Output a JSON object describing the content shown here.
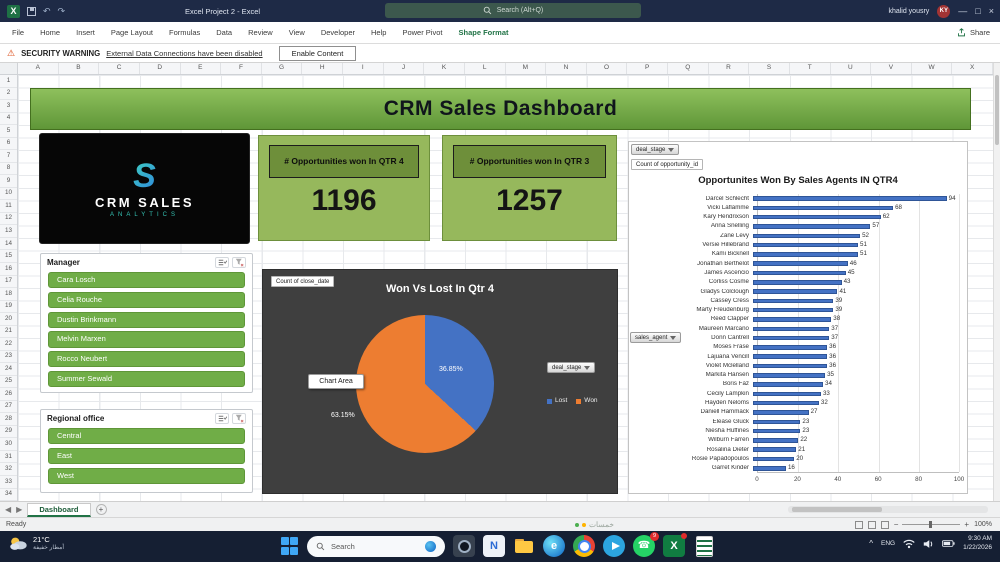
{
  "titlebar": {
    "title": "Excel Project 2 - Excel",
    "search_placeholder": "Search (Alt+Q)",
    "user_name": "khalid yousry",
    "user_initials": "KY"
  },
  "ribbon": {
    "tabs": [
      "File",
      "Home",
      "Insert",
      "Page Layout",
      "Formulas",
      "Data",
      "Review",
      "View",
      "Developer",
      "Help",
      "Power Pivot",
      "Shape Format"
    ],
    "active_tab": "Shape Format",
    "share_label": "Share"
  },
  "security_bar": {
    "label": "SECURITY WARNING",
    "message": "External Data Connections have been disabled",
    "button_label": "Enable Content"
  },
  "grid": {
    "columns": [
      "A",
      "B",
      "C",
      "D",
      "E",
      "F",
      "G",
      "H",
      "I",
      "J",
      "K",
      "L",
      "M",
      "N",
      "O",
      "P",
      "Q",
      "R",
      "S",
      "T",
      "U",
      "V",
      "W",
      "X"
    ],
    "row_count": 34
  },
  "dashboard": {
    "banner_title": "CRM Sales Dashboard",
    "logo": {
      "symbol": "S",
      "line1": "CRM SALES",
      "line2": "ANALYTICS"
    },
    "kpis": [
      {
        "label": "# Opportunities won In QTR 4",
        "value": "1196"
      },
      {
        "label": "# Opportunities won In QTR 3",
        "value": "1257"
      }
    ],
    "slicers": [
      {
        "title": "Manager",
        "items": [
          "Cara Losch",
          "Celia Rouche",
          "Dustin Brinkmann",
          "Melvin Marxen",
          "Rocco Neubert",
          "Summer Sewald"
        ]
      },
      {
        "title": "Regional office",
        "items": [
          "Central",
          "East",
          "West"
        ]
      }
    ],
    "field_buttons": {
      "pie_value_field": "Count of close_date",
      "pie_filter": "deal_stage",
      "bar_filter": "deal_stage",
      "bar_value_field": "Count of opportunity_id",
      "bar_axis_field": "sales_agent"
    },
    "chart_area_tooltip": "Chart Area"
  },
  "chart_data": [
    {
      "type": "pie",
      "title": "Won Vs Lost In Qtr 4",
      "labels": [
        "Lost",
        "Won"
      ],
      "values": [
        36.85,
        63.15
      ],
      "data_labels": [
        "36.85%",
        "63.15%"
      ],
      "colors": [
        "#4472c4",
        "#ed7d31"
      ],
      "legend_position": "right"
    },
    {
      "type": "bar",
      "orientation": "horizontal",
      "title": "Opportunites Won By Sales Agents IN QTR4",
      "categories": [
        "Darcel Schlecht",
        "Vicki Laflamme",
        "Kary Hendrixson",
        "Anna Snelling",
        "Zane Levy",
        "Versie Hillebrand",
        "Kami Bicknell",
        "Jonathan Berthelot",
        "James Ascencio",
        "Corliss Cosme",
        "Gladys Colclough",
        "Cassey Cress",
        "Marty Freudenburg",
        "Reed Clapper",
        "Maureen Marcano",
        "Donn Cantrell",
        "Moses Frase",
        "Lajuana Vencill",
        "Violet Mclelland",
        "Markita Hansen",
        "Boris Faz",
        "Cecily Lampkin",
        "Hayden Neloms",
        "Daniell Hammack",
        "Elease Gluck",
        "Niesha Huffines",
        "Wilburn Farren",
        "Rosalina Dieter",
        "Rosie Papadopoulos",
        "Garret Kinder"
      ],
      "values": [
        94,
        68,
        62,
        57,
        52,
        51,
        51,
        46,
        45,
        43,
        41,
        39,
        39,
        38,
        37,
        37,
        36,
        36,
        36,
        35,
        34,
        33,
        32,
        27,
        23,
        23,
        22,
        21,
        20,
        16
      ],
      "xlim": [
        0,
        100
      ],
      "x_ticks": [
        0,
        20,
        40,
        60,
        80,
        100
      ],
      "bar_color": "#4472c4"
    }
  ],
  "sheet_tabs": {
    "active_tab": "Dashboard"
  },
  "status_bar": {
    "ready_label": "Ready",
    "zoom_level": "100%",
    "watermark": "خمسات"
  },
  "taskbar": {
    "weather": {
      "temp": "21°C",
      "desc": "أمطار خفيفة"
    },
    "search_placeholder": "Search",
    "apps": [
      {
        "name": "camera",
        "badge": ""
      },
      {
        "name": "notepad",
        "badge": ""
      },
      {
        "name": "file-explorer",
        "badge": ""
      },
      {
        "name": "edge",
        "badge": ""
      },
      {
        "name": "chrome",
        "badge": ""
      },
      {
        "name": "telegram",
        "badge": ""
      },
      {
        "name": "whatsapp",
        "badge": "9"
      },
      {
        "name": "excel",
        "badge": "dot"
      },
      {
        "name": "excel-file",
        "badge": ""
      }
    ],
    "tray": {
      "language": "ENG",
      "time": "9:30 AM",
      "date": "1/22/2026"
    }
  }
}
